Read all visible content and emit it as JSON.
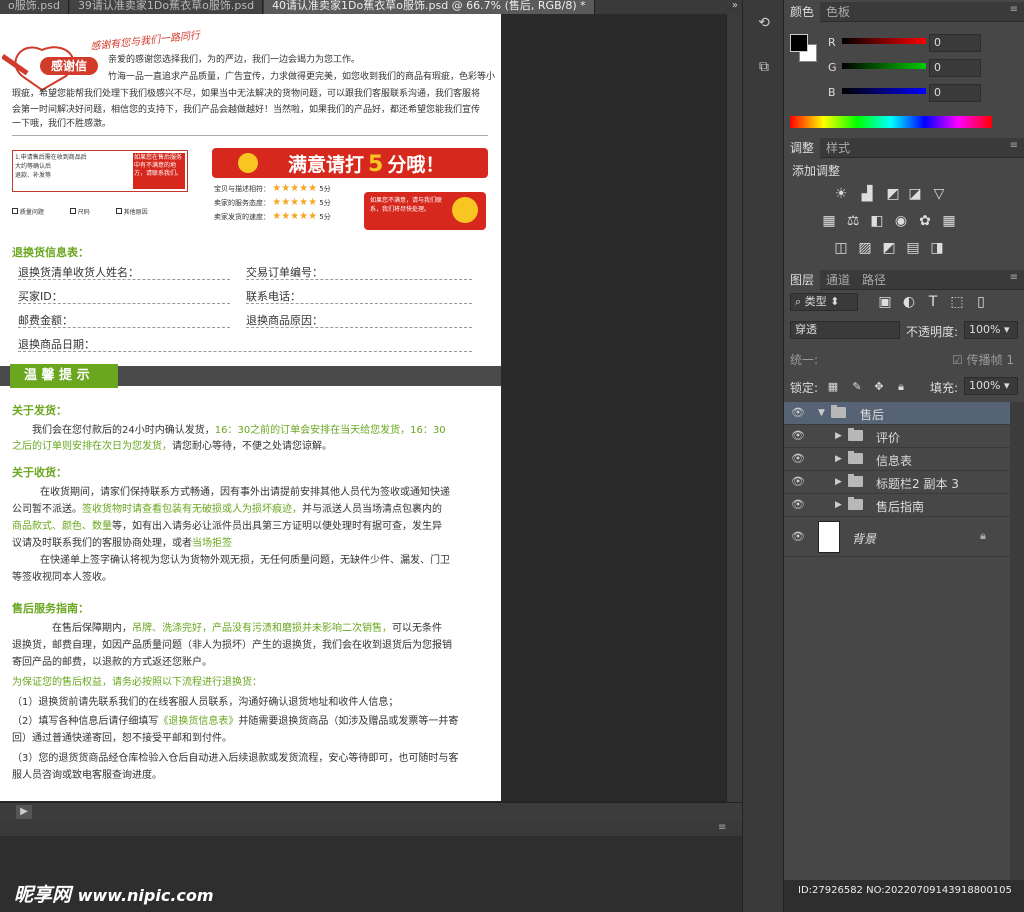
{
  "tabs": [
    {
      "label": "o服饰.psd"
    },
    {
      "label": "39请认准卖家1Do蕉衣草o服饰.psd"
    },
    {
      "label": "40请认准卖家1Do蕉衣草o服饰.psd @ 66.7% (售后, RGB/8) *"
    }
  ],
  "tab_more": "»",
  "document": {
    "thanks_sub": "感谢有您与我们一路同行",
    "thanks_title": "感谢信",
    "thanks_body_1": "亲爱的感谢您选择我们，为的严边，我们一边会竭力为您工作。",
    "thanks_body_2": "竹海一品一直追求产品质量，广告宣传，力求做得更完美，如您收到我们的商品有瑕疵，色彩等小",
    "thanks_body_3": "瑕疵，希望您能帮我们处理下我们极感兴不尽，如果当中无法解决的货物问题，可以跟我们客服联系沟通，我们客服将",
    "thanks_body_4": "会第一时间解决好问题，相信您的支持下，我们产品会越做越好！当然啦，如果我们的产品好，都还希望您能我们宣传",
    "thanks_body_5": "一下哦，我们不胜感激。",
    "left_box_1": "1.申请售后需在收到商品后",
    "left_box_2": "大约等确认后",
    "left_box_3": "退款、补发等",
    "left_box_right": "如果您在售后服务中有不满意的地方，请联系我们。",
    "check_1": "质量问题",
    "check_2": "尺码",
    "check_3": "其他原因",
    "rate_banner": "满意请打",
    "rate_five": "5",
    "rate_end": "分哦！",
    "rate_rows": [
      {
        "label": "宝贝与描述相符：",
        "score": "5分"
      },
      {
        "label": "卖家的服务态度：",
        "score": "5分"
      },
      {
        "label": "卖家发货的速度：",
        "score": "5分"
      }
    ],
    "rate_note": "如果您不满意，请与我们联系，我们将尽快处理。",
    "info_title": "退换货信息表：",
    "fields": {
      "name": "退换货清单收货人姓名：",
      "order": "交易订单编号：",
      "buyer_id": "买家ID：",
      "phone": "联系电话：",
      "postcode": "邮费金额：",
      "reason": "退换商品原因：",
      "date": "退换商品日期："
    },
    "tips_title": "温 馨 提 示",
    "ship_title": "关于发货：",
    "ship_text_1": "我们会在您付款后的24小时内确认发货，",
    "ship_text_green_1": "16：30之前的订单会安排在当天给您发货，16：30",
    "ship_text_green_2": "之后的订单则安排在次日为您发货，",
    "ship_text_2": "请您耐心等待，不便之处请您谅解。",
    "recv_title": "关于收货：",
    "recv_text_1": "在收货期间，请家们保持联系方式畅通，因有事外出请提前安排其他人员代为签收或通知快递",
    "recv_text_2": "公司暂不派送。",
    "recv_green_1": "签收货物时请查看包装有无破损或人为损坏痕迹，",
    "recv_text_3": "并与派送人员当场清点包裹内的",
    "recv_green_2": "商品款式、颜色、数量",
    "recv_text_4": "等，如有出入请务必让派件员出具第三方证明以便处理时有据可查，发生异",
    "recv_text_5": "议请及时联系我们的客服协商处理，或者",
    "recv_green_3": "当场拒签",
    "recv_text_6": "在快递单上签字确认将视为您认为货物外观无损，无任何质量问题，无缺件少件、漏发、门卫",
    "recv_text_7": "等签收视同本人签收。",
    "after_title": "售后服务指南：",
    "after_text_1": "在售后保障期内，",
    "after_green_1": "吊牌、洗涤完好，产品没有污渍和磨损并未影响二次销售，",
    "after_text_2": "可以无条件",
    "after_text_3": "退换货，邮费自理，如因产品质量问题（非人为损坏）产生的退换货，我们会在收到退货后为您报销",
    "after_text_4": "寄回产品的邮费，以退款的方式返还您账户。",
    "after_green_2": "为保证您的售后权益，请务必按照以下流程进行退换货：",
    "step_1": "（1）退换货前请先联系我们的在线客服人员联系，沟通好确认退货地址和收件人信息；",
    "step_2": "（2）填写各种信息后请仔细填写",
    "step_2_green": "《退换货信息表》",
    "step_2b": "并随需要退换货商品（如涉及赠品或发票等一并寄",
    "step_2c": "回）通过普通快递寄回，恕不接受平邮和到付件。",
    "step_3": "（3）您的退货货商品经仓库检验入仓后自动进入后续退款或发货流程，安心等待即可，也可随时与客",
    "step_3b": "服人员咨询或致电客服查询进度。"
  },
  "color_panel": {
    "tab_color": "颜色",
    "tab_swatches": "色板",
    "r_label": "R",
    "g_label": "G",
    "b_label": "B",
    "r_value": "0",
    "g_value": "0",
    "b_value": "0"
  },
  "adjust_panel": {
    "tab_adjust": "调整",
    "tab_style": "样式",
    "add_label": "添加调整"
  },
  "layers_panel": {
    "tab_layers": "图层",
    "tab_channels": "通道",
    "tab_paths": "路径",
    "filter_kind": "类型",
    "blend_mode": "穿透",
    "opacity_label": "不透明度:",
    "opacity_value": "100%",
    "unify_label": "统一:",
    "propagate_label": "传播帧",
    "propagate_value": "1",
    "lock_label": "锁定:",
    "fill_label": "填充:",
    "fill_value": "100%",
    "layers": [
      {
        "name": "售后"
      },
      {
        "name": "评价"
      },
      {
        "name": "信息表"
      },
      {
        "name": "标题栏2 副本 3"
      },
      {
        "name": "售后指南"
      },
      {
        "name": "背景"
      }
    ]
  },
  "status_id": "ID:27926582 NO:20220709143918800105",
  "watermark": {
    "brand": "昵享网",
    "url": "www.nipic.com"
  },
  "colors": {
    "accent_green": "#6aa71f",
    "banner_red": "#d6281d",
    "selected_layer": "#566375"
  }
}
